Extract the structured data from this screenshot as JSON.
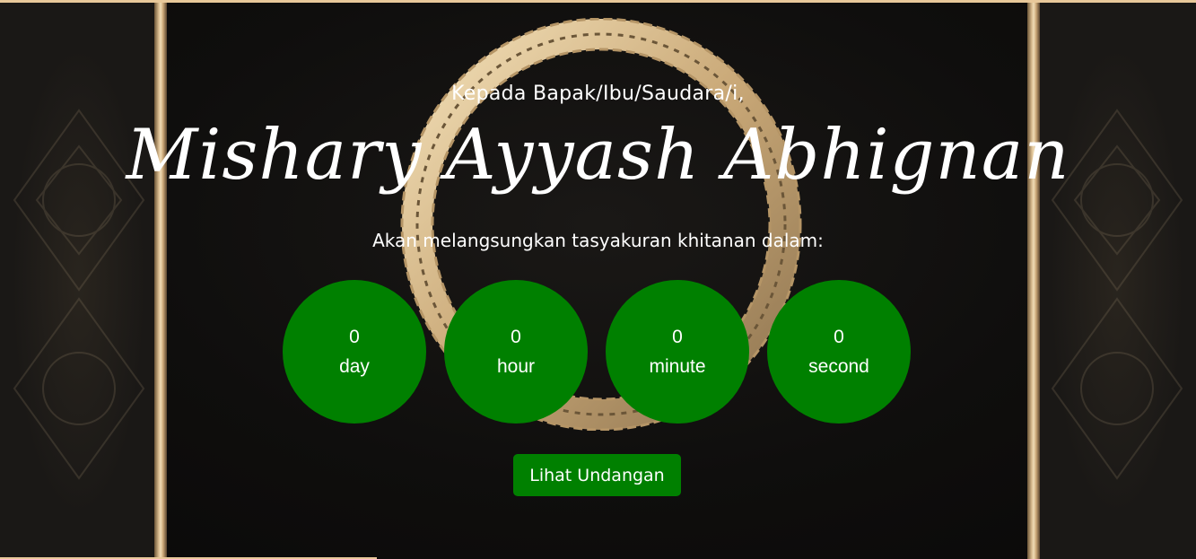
{
  "greeting": "Kepada Bapak/Ibu/Saudara/i,",
  "guest_name": "Mishary Ayyash Abhignan",
  "subtitle": "Akan melangsungkan tasyakuran khitanan dalam:",
  "countdown": {
    "days": {
      "value": "0",
      "label": "day"
    },
    "hours": {
      "value": "0",
      "label": "hour"
    },
    "minutes": {
      "value": "0",
      "label": "minute"
    },
    "seconds": {
      "value": "0",
      "label": "second"
    }
  },
  "cta_label": "Lihat Undangan",
  "colors": {
    "accent_green": "#008000",
    "gold": "#e8c89a",
    "background": "#0f0e0d",
    "text": "#ffffff"
  }
}
